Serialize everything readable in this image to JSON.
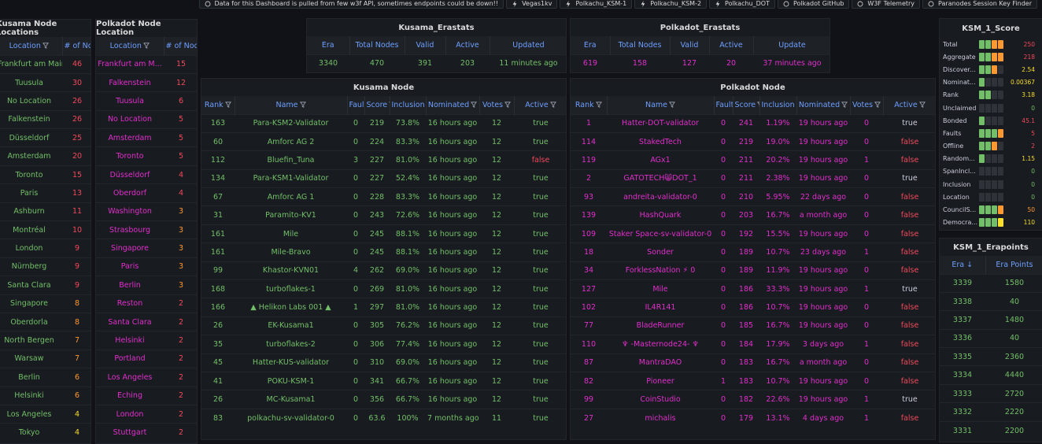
{
  "topbar": [
    {
      "icon": "info-circle-icon",
      "label": "Data for this Dashboard is pulled from few w3f API, sometimes endpoints could be down!!"
    },
    {
      "icon": "bolt-icon",
      "label": "Vegas1kv"
    },
    {
      "icon": "bolt-icon",
      "label": "Polkachu_KSM-1"
    },
    {
      "icon": "bolt-icon",
      "label": "Polkachu_KSM-2"
    },
    {
      "icon": "bolt-icon",
      "label": "Polkachu_DOT"
    },
    {
      "icon": "github-icon",
      "label": "Polkadot GitHub"
    },
    {
      "icon": "cloud-icon",
      "label": "W3F Telemetry"
    },
    {
      "icon": "cloud-icon",
      "label": "Paranodes Session Key Finder"
    }
  ],
  "kusama_locations": {
    "title": "Kusama Node Locations",
    "headers": [
      "Location",
      "# of Nodes"
    ],
    "rows": [
      [
        "Frankfurt am Main",
        "46",
        "r"
      ],
      [
        "Tuusula",
        "30",
        "r"
      ],
      [
        "No Location",
        "26",
        "r"
      ],
      [
        "Falkenstein",
        "26",
        "r"
      ],
      [
        "Düsseldorf",
        "25",
        "r"
      ],
      [
        "Amsterdam",
        "20",
        "r"
      ],
      [
        "Toronto",
        "15",
        "r"
      ],
      [
        "Paris",
        "13",
        "r"
      ],
      [
        "Ashburn",
        "11",
        "r"
      ],
      [
        "Montréal",
        "10",
        "r"
      ],
      [
        "London",
        "9",
        "r"
      ],
      [
        "Nürnberg",
        "9",
        "r"
      ],
      [
        "Santa Clara",
        "9",
        "r"
      ],
      [
        "Singapore",
        "8",
        "o"
      ],
      [
        "Oberdorla",
        "8",
        "o"
      ],
      [
        "North Bergen",
        "7",
        "o"
      ],
      [
        "Warsaw",
        "7",
        "o"
      ],
      [
        "Berlin",
        "6",
        "o"
      ],
      [
        "Helsinki",
        "6",
        "o"
      ],
      [
        "Los Angeles",
        "4",
        "y"
      ],
      [
        "Tokyo",
        "4",
        "y"
      ]
    ]
  },
  "polkadot_locations": {
    "title": "Polkadot Node Location",
    "headers": [
      "Location",
      "# of Nodes"
    ],
    "rows": [
      [
        "Frankfurt am M...",
        "15",
        "r"
      ],
      [
        "Falkenstein",
        "12",
        "r"
      ],
      [
        "Tuusula",
        "6",
        "r"
      ],
      [
        "No Location",
        "5",
        "r"
      ],
      [
        "Amsterdam",
        "5",
        "r"
      ],
      [
        "Toronto",
        "5",
        "r"
      ],
      [
        "Düsseldorf",
        "4",
        "r"
      ],
      [
        "Oberdorf",
        "4",
        "r"
      ],
      [
        "Washington",
        "3",
        "o"
      ],
      [
        "Strasbourg",
        "3",
        "o"
      ],
      [
        "Singapore",
        "3",
        "o"
      ],
      [
        "Paris",
        "3",
        "o"
      ],
      [
        "Berlin",
        "3",
        "o"
      ],
      [
        "Reston",
        "2",
        "r"
      ],
      [
        "Santa Clara",
        "2",
        "r"
      ],
      [
        "Helsinki",
        "2",
        "r"
      ],
      [
        "Portland",
        "2",
        "r"
      ],
      [
        "Los Angeles",
        "2",
        "r"
      ],
      [
        "Eching",
        "2",
        "r"
      ],
      [
        "London",
        "2",
        "r"
      ],
      [
        "Stuttgart",
        "2",
        "r"
      ]
    ]
  },
  "kusama_erastats": {
    "title": "Kusama_Erastats",
    "headers": [
      "Era",
      "Total Nodes",
      "Valid",
      "Active",
      "Updated"
    ],
    "row": [
      "3340",
      "470",
      "391",
      "203",
      "11 minutes ago"
    ]
  },
  "polkadot_erastats": {
    "title": "Polkadot_Erastats",
    "headers": [
      "Era",
      "Total Nodes",
      "Valid",
      "Active",
      "Update"
    ],
    "row": [
      "619",
      "158",
      "127",
      "20",
      "37 minutes ago"
    ]
  },
  "kusama_node": {
    "title": "Kusama Node",
    "headers": [
      "Rank",
      "Name",
      "Faults",
      "Score",
      "Inclusion",
      "Nominated",
      "Votes",
      "Active"
    ],
    "rows": [
      [
        "163",
        "Para-KSM2-Validator",
        "0",
        "219",
        "73.8%",
        "16 hours ago",
        "12",
        "true"
      ],
      [
        "60",
        "Amforc AG 2",
        "0",
        "224",
        "83.3%",
        "16 hours ago",
        "12",
        "true"
      ],
      [
        "112",
        "Bluefin_Tuna",
        "3",
        "227",
        "81.0%",
        "16 hours ago",
        "12",
        "false"
      ],
      [
        "134",
        "Para-KSM1-Validator",
        "0",
        "227",
        "52.4%",
        "16 hours ago",
        "12",
        "true"
      ],
      [
        "67",
        "Amforc AG 1",
        "0",
        "228",
        "83.3%",
        "16 hours ago",
        "12",
        "true"
      ],
      [
        "31",
        "Paramito-KV1",
        "0",
        "243",
        "72.6%",
        "16 hours ago",
        "12",
        "true"
      ],
      [
        "161",
        "Mile",
        "0",
        "245",
        "88.1%",
        "16 hours ago",
        "12",
        "true"
      ],
      [
        "161",
        "Mile-Bravo",
        "0",
        "245",
        "88.1%",
        "16 hours ago",
        "12",
        "true"
      ],
      [
        "99",
        "Khastor-KVN01",
        "4",
        "262",
        "69.0%",
        "16 hours ago",
        "12",
        "true"
      ],
      [
        "168",
        "turboflakes-1",
        "0",
        "269",
        "81.0%",
        "16 hours ago",
        "12",
        "true"
      ],
      [
        "166",
        "▲ Helikon Labs 001 ▲",
        "1",
        "297",
        "81.0%",
        "16 hours ago",
        "12",
        "true"
      ],
      [
        "26",
        "EK-Kusama1",
        "0",
        "305",
        "76.2%",
        "16 hours ago",
        "12",
        "true"
      ],
      [
        "35",
        "turboflakes-2",
        "0",
        "306",
        "77.4%",
        "16 hours ago",
        "12",
        "true"
      ],
      [
        "45",
        "Hatter-KUS-validator",
        "0",
        "310",
        "69.0%",
        "16 hours ago",
        "12",
        "true"
      ],
      [
        "41",
        "POKU-KSM-1",
        "0",
        "341",
        "66.7%",
        "16 hours ago",
        "12",
        "true"
      ],
      [
        "26",
        "MC-Kusama1",
        "0",
        "356",
        "66.7%",
        "16 hours ago",
        "12",
        "true"
      ],
      [
        "83",
        "polkachu-sv-validator-0",
        "0",
        "63.6",
        "100%",
        "7 months ago",
        "11",
        "true"
      ]
    ]
  },
  "polkadot_node": {
    "title": "Polkadot Node",
    "headers": [
      "Rank",
      "Name",
      "Faults",
      "Score",
      "Inclusion",
      "Nominated",
      "Votes",
      "Active"
    ],
    "rows": [
      [
        "1",
        "Hatter-DOT-validator",
        "0",
        "241",
        "1.19%",
        "19 hours ago",
        "0",
        "true"
      ],
      [
        "114",
        "StakedTech",
        "0",
        "219",
        "19.0%",
        "19 hours ago",
        "0",
        "false"
      ],
      [
        "119",
        "AGx1",
        "0",
        "211",
        "20.2%",
        "19 hours ago",
        "1",
        "false"
      ],
      [
        "2",
        "GATOTECH😸DOT_1",
        "0",
        "211",
        "2.38%",
        "19 hours ago",
        "0",
        "true"
      ],
      [
        "93",
        "andreita-validator-0",
        "0",
        "210",
        "5.95%",
        "22 days ago",
        "0",
        "false"
      ],
      [
        "139",
        "HashQuark",
        "0",
        "203",
        "16.7%",
        "a month ago",
        "0",
        "false"
      ],
      [
        "109",
        "Staker Space-sv-validator-0",
        "0",
        "192",
        "15.5%",
        "19 hours ago",
        "0",
        "false"
      ],
      [
        "18",
        "Sonder",
        "0",
        "189",
        "10.7%",
        "23 days ago",
        "1",
        "false"
      ],
      [
        "34",
        "ForklessNation ⚡ 0",
        "0",
        "189",
        "11.9%",
        "19 hours ago",
        "0",
        "false"
      ],
      [
        "127",
        "Mile",
        "0",
        "186",
        "33.3%",
        "19 hours ago",
        "1",
        "true"
      ],
      [
        "102",
        "IL4R141",
        "0",
        "186",
        "10.7%",
        "19 hours ago",
        "0",
        "false"
      ],
      [
        "77",
        "BladeRunner",
        "0",
        "185",
        "16.7%",
        "19 hours ago",
        "0",
        "false"
      ],
      [
        "110",
        "♆ -Masternode24- ♆",
        "0",
        "184",
        "17.9%",
        "3 days ago",
        "1",
        "false"
      ],
      [
        "87",
        "MantraDAO",
        "0",
        "183",
        "16.7%",
        "a month ago",
        "0",
        "false"
      ],
      [
        "82",
        "Pioneer",
        "1",
        "183",
        "10.7%",
        "19 hours ago",
        "0",
        "false"
      ],
      [
        "99",
        "CoinStudio",
        "0",
        "182",
        "22.6%",
        "19 hours ago",
        "1",
        "true"
      ],
      [
        "27",
        "michalis",
        "0",
        "179",
        "13.1%",
        "4 days ago",
        "1",
        "false"
      ]
    ]
  },
  "ksm_score": {
    "title": "KSM_1_Score",
    "rows": [
      {
        "label": "Total",
        "value": "250",
        "c": "r",
        "bars": [
          "g",
          "g",
          "o",
          "o"
        ]
      },
      {
        "label": "Aggregate",
        "value": "218",
        "c": "r",
        "bars": [
          "g",
          "g",
          "o",
          "o"
        ]
      },
      {
        "label": "Discover...",
        "value": "2.54",
        "c": "y",
        "bars": [
          "g",
          "g",
          "o",
          "d"
        ]
      },
      {
        "label": "Nominat...",
        "value": "0.00367",
        "c": "y",
        "bars": [
          "g",
          "d",
          "d",
          "d"
        ]
      },
      {
        "label": "Rank",
        "value": "3.18",
        "c": "y",
        "bars": [
          "g",
          "g",
          "d",
          "d"
        ]
      },
      {
        "label": "Unclaimed",
        "value": "0",
        "c": "g",
        "bars": [
          "d",
          "d",
          "d",
          "d"
        ]
      },
      {
        "label": "Bonded",
        "value": "45.1",
        "c": "r",
        "bars": [
          "g",
          "d",
          "d",
          "d"
        ]
      },
      {
        "label": "Faults",
        "value": "5",
        "c": "r",
        "bars": [
          "g",
          "g",
          "g",
          "o"
        ]
      },
      {
        "label": "Offline",
        "value": "2",
        "c": "r",
        "bars": [
          "g",
          "g",
          "o",
          "d"
        ]
      },
      {
        "label": "Random...",
        "value": "1.15",
        "c": "y",
        "bars": [
          "g",
          "d",
          "d",
          "d"
        ]
      },
      {
        "label": "SpanIncl...",
        "value": "0",
        "c": "g",
        "bars": [
          "d",
          "d",
          "d",
          "d"
        ]
      },
      {
        "label": "Inclusion",
        "value": "0",
        "c": "g",
        "bars": [
          "d",
          "d",
          "d",
          "d"
        ]
      },
      {
        "label": "Location",
        "value": "0",
        "c": "g",
        "bars": [
          "d",
          "d",
          "d",
          "d"
        ]
      },
      {
        "label": "CouncilS...",
        "value": "50",
        "c": "o",
        "bars": [
          "g",
          "g",
          "g",
          "o"
        ]
      },
      {
        "label": "Democra...",
        "value": "110",
        "c": "y",
        "bars": [
          "g",
          "g",
          "g",
          "y"
        ]
      }
    ]
  },
  "ksm_erapoints": {
    "title": "KSM_1_Erapoints",
    "headers": [
      "Era ↓",
      "Era Points"
    ],
    "rows": [
      [
        "3339",
        "1580"
      ],
      [
        "3338",
        "40"
      ],
      [
        "3337",
        "1480"
      ],
      [
        "3336",
        "40"
      ],
      [
        "3335",
        "2360"
      ],
      [
        "3334",
        "4440"
      ],
      [
        "3333",
        "2720"
      ],
      [
        "3332",
        "2220"
      ],
      [
        "3331",
        "2200"
      ]
    ]
  },
  "colors": {
    "green": "#73bf69",
    "red": "#f2495c",
    "yellow": "#fade2a",
    "orange": "#ff9830",
    "magenta": "#e02fcc",
    "link": "#6e9fff"
  }
}
